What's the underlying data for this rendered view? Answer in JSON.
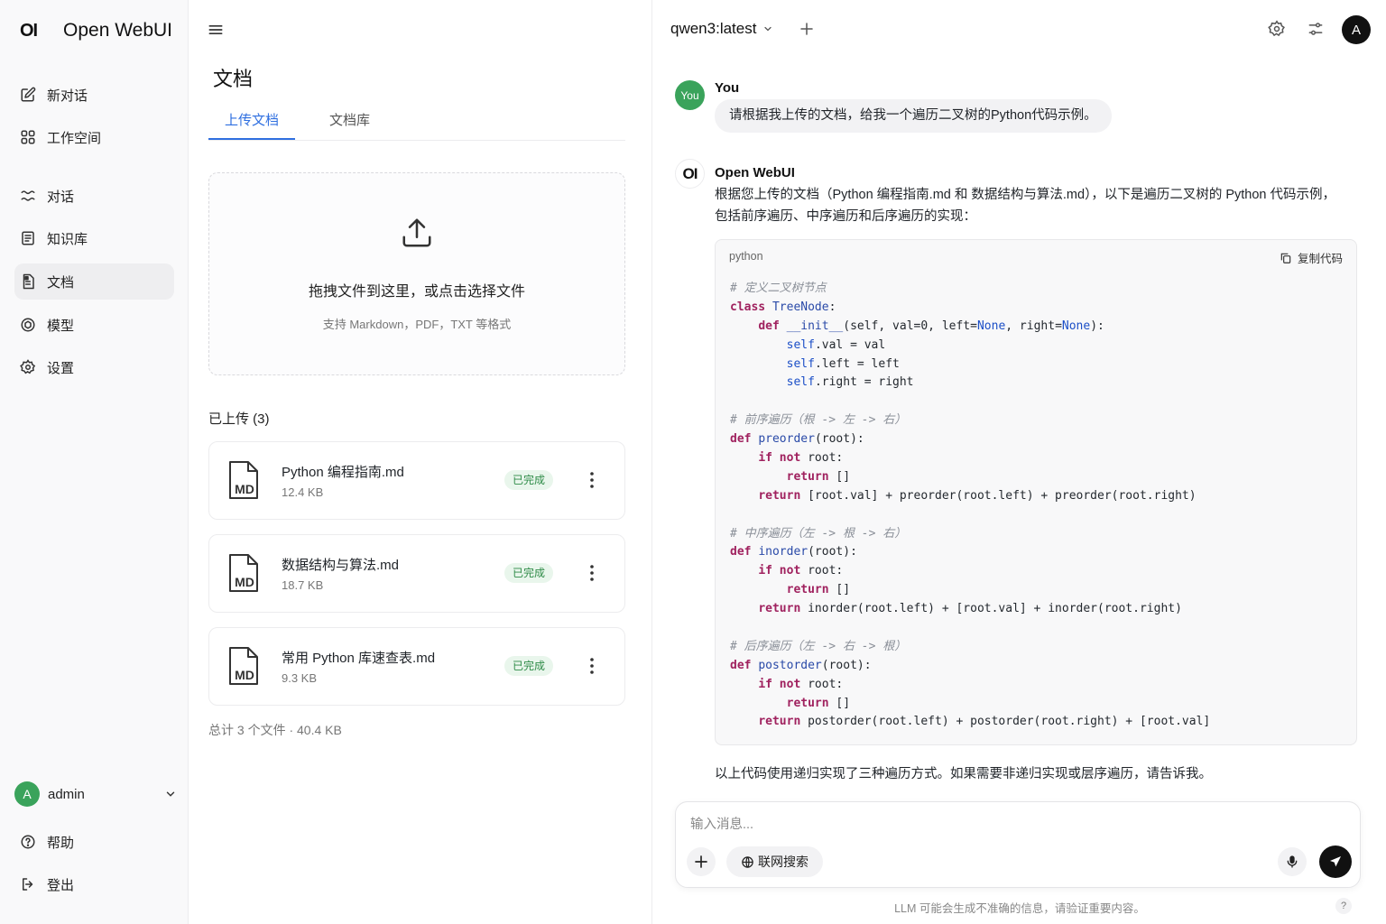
{
  "brand": {
    "logo": "OI",
    "name": "Open WebUI"
  },
  "sidebar": {
    "items": [
      {
        "label": "新对话",
        "icon": "new-chat-icon"
      },
      {
        "label": "工作空间",
        "icon": "workspace-icon"
      },
      {
        "label": "对话",
        "icon": "chats-icon"
      },
      {
        "label": "知识库",
        "icon": "knowledge-icon"
      },
      {
        "label": "文档",
        "icon": "document-icon",
        "active": true
      },
      {
        "label": "模型",
        "icon": "model-icon"
      },
      {
        "label": "设置",
        "icon": "gear-icon"
      }
    ],
    "user": {
      "initial": "A",
      "name": "admin"
    },
    "bottom": [
      {
        "label": "帮助",
        "icon": "help-icon"
      },
      {
        "label": "登出",
        "icon": "logout-icon"
      }
    ]
  },
  "docs": {
    "title": "文档",
    "tabs": [
      "上传文档",
      "文档库"
    ],
    "dropzone": {
      "main": "拖拽文件到这里，或点击选择文件",
      "sub": "支持 Markdown，PDF，TXT 等格式"
    },
    "uploaded_title": "已上传 (3)",
    "files": [
      {
        "name": "Python 编程指南.md",
        "size": "12.4 KB",
        "status": "已完成",
        "type": "MD"
      },
      {
        "name": "数据结构与算法.md",
        "size": "18.7 KB",
        "status": "已完成",
        "type": "MD"
      },
      {
        "name": "常用 Python 库速查表.md",
        "size": "9.3 KB",
        "status": "已完成",
        "type": "MD"
      }
    ],
    "total": "总计 3 个文件 · 40.4 KB"
  },
  "chat": {
    "model": "qwen3:latest",
    "user_avatar": "A",
    "user": {
      "avatar_label": "You",
      "name": "You",
      "message": "请根据我上传的文档，给我一个遍历二叉树的Python代码示例。"
    },
    "bot": {
      "avatar_label": "OI",
      "name": "Open WebUI",
      "intro_line1": "根据您上传的文档（Python 编程指南.md 和 数据结构与算法.md），以下是遍历二叉树的 Python 代码示例，",
      "intro_line2": "包括前序遍历、中序遍历和后序遍历的实现：",
      "code_lang": "python",
      "copy_label": "复制代码",
      "footer": "以上代码使用递归实现了三种遍历方式。如果需要非递归实现或层序遍历，请告诉我。"
    },
    "composer": {
      "placeholder": "输入消息...",
      "web_search": "联网搜索"
    },
    "disclaimer": "LLM 可能会生成不准确的信息，请验证重要内容。",
    "help": "?"
  },
  "colors": {
    "accent": "#2f6fe0",
    "success_bg": "#e9f6ec",
    "success_text": "#2e8b47",
    "avatar_green": "#3aa35b",
    "sidebar_bg": "#f9f9fa"
  }
}
